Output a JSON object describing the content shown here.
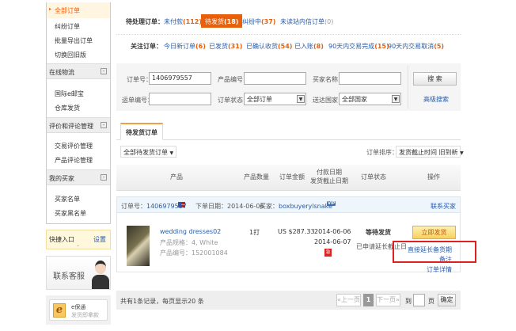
{
  "sidebar": {
    "orders": [
      "全部订单",
      "纠纷订单",
      "批量导出订单",
      "切换回旧版"
    ],
    "sections": [
      {
        "title": "在线物流",
        "items": [
          "国际e邮宝",
          "仓库发货"
        ]
      },
      {
        "title": "评价和评论管理",
        "items": [
          "交易评价管理",
          "产品评论管理"
        ]
      },
      {
        "title": "我的买家",
        "items": [
          "买家名单",
          "买家黑名单"
        ]
      }
    ],
    "toggle": "-",
    "quick": {
      "title": "快捷入口",
      "settings": "设置"
    },
    "service": "联系客服",
    "ebao": {
      "icon": "e",
      "title": "e保通",
      "sub": "发货即拿款"
    }
  },
  "pending": {
    "label": "待处理订单：",
    "tabs": [
      {
        "name": "未付款",
        "count": "(112)"
      },
      {
        "name": "待发货",
        "count": "(18)"
      },
      {
        "name": "纠纷中",
        "count": "(37)"
      },
      {
        "name": "未读站内信订单",
        "count": "(0)"
      }
    ]
  },
  "watch": {
    "label": "关注订单：",
    "tabs": [
      {
        "name": "今日新订单",
        "count": "(6)"
      },
      {
        "name": "已发货",
        "count": "(31)"
      },
      {
        "name": "已确认收货",
        "count": "(54)"
      },
      {
        "name": "已入账",
        "count": "(8)"
      },
      {
        "name": "90天内交易完成",
        "count": "(15)"
      },
      {
        "name": "90天内交易取消",
        "count": "(5)"
      }
    ]
  },
  "search": {
    "order_no_label": "订单号：",
    "order_no": "1406979557",
    "product_no_label": "产品编号：",
    "buyer_label": "买家名称：",
    "waybill_label": "运单编号：",
    "status_label": "订单状态：",
    "status": "全部订单",
    "country_label": "送达国家：",
    "country": "全部国家",
    "search_btn": "搜 索",
    "advanced": "高级搜索"
  },
  "list": {
    "tab": "待发货订单",
    "filter": "全部待发货订单",
    "sort_label": "订单排序：",
    "sort": "发货截止时间 旧到新",
    "headers": [
      "产品",
      "产品数量",
      "订单金额",
      "付款日期",
      "发货截止日期",
      "订单状态",
      "操作"
    ]
  },
  "order": {
    "no_label": "订单号：",
    "no": "1406979557",
    "date_label": "下单日期：",
    "date": "2014-06-06",
    "buyer_label": "买家：",
    "buyer": "boxbuyerylsnake",
    "vip": "VIP",
    "contact": "联系买家",
    "product": "wedding dresses02",
    "spec": "产品规格：4, White",
    "pid": "产品编号：152001084",
    "qty": "1打",
    "amount": "US $287.33",
    "pay_date": "2014-06-06",
    "deadline": "2014-06-07",
    "urgent": "急",
    "status": "等待发货",
    "status_note": "已申请延长截止日",
    "ship_btn": "立即发货",
    "extend": "直接延长备货期",
    "remark": "备注",
    "detail": "订单详情"
  },
  "pager": {
    "summary": "共有1条记录，每页显示20 条",
    "prev": "«上一页",
    "page": "1",
    "next": "下一页»",
    "goto": "到",
    "page_unit": "页",
    "confirm": "确定"
  }
}
